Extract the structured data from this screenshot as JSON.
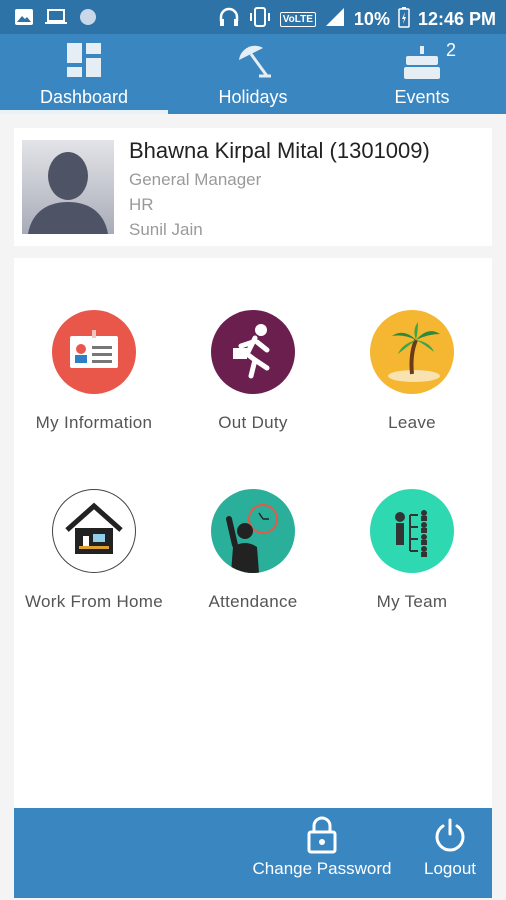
{
  "status_bar": {
    "icons_left": [
      "image-icon",
      "laptop-icon",
      "circle-icon"
    ],
    "volte": "VoLTE",
    "battery": "10%",
    "time": "12:46 PM"
  },
  "tabs": [
    {
      "label": "Dashboard",
      "icon": "dashboard-icon",
      "active": true
    },
    {
      "label": "Holidays",
      "icon": "beach-umbrella-icon"
    },
    {
      "label": "Events",
      "icon": "cake-icon",
      "badge": "2"
    }
  ],
  "profile": {
    "name": "Bhawna Kirpal Mital (1301009)",
    "designation": "General Manager",
    "department": "HR",
    "manager": "Sunil Jain"
  },
  "tiles": [
    {
      "label": "My Information",
      "icon": "id-card-icon",
      "color": "#e8574a"
    },
    {
      "label": "Out Duty",
      "icon": "running-man-icon",
      "color": "#6b1f4e"
    },
    {
      "label": "Leave",
      "icon": "palm-tree-icon",
      "color": "#f5b731"
    },
    {
      "label": "Work From Home",
      "icon": "house-icon",
      "color": "#ffffff"
    },
    {
      "label": "Attendance",
      "icon": "raised-hand-icon",
      "color": "#2ab09a"
    },
    {
      "label": "My Team",
      "icon": "team-hierarchy-icon",
      "color": "#2ed8b0"
    }
  ],
  "footer": {
    "change_password": "Change Password",
    "logout": "Logout"
  },
  "colors": {
    "status_bar": "#2e73a8",
    "tab_bar": "#3a86c1",
    "footer": "#3a86c1"
  }
}
